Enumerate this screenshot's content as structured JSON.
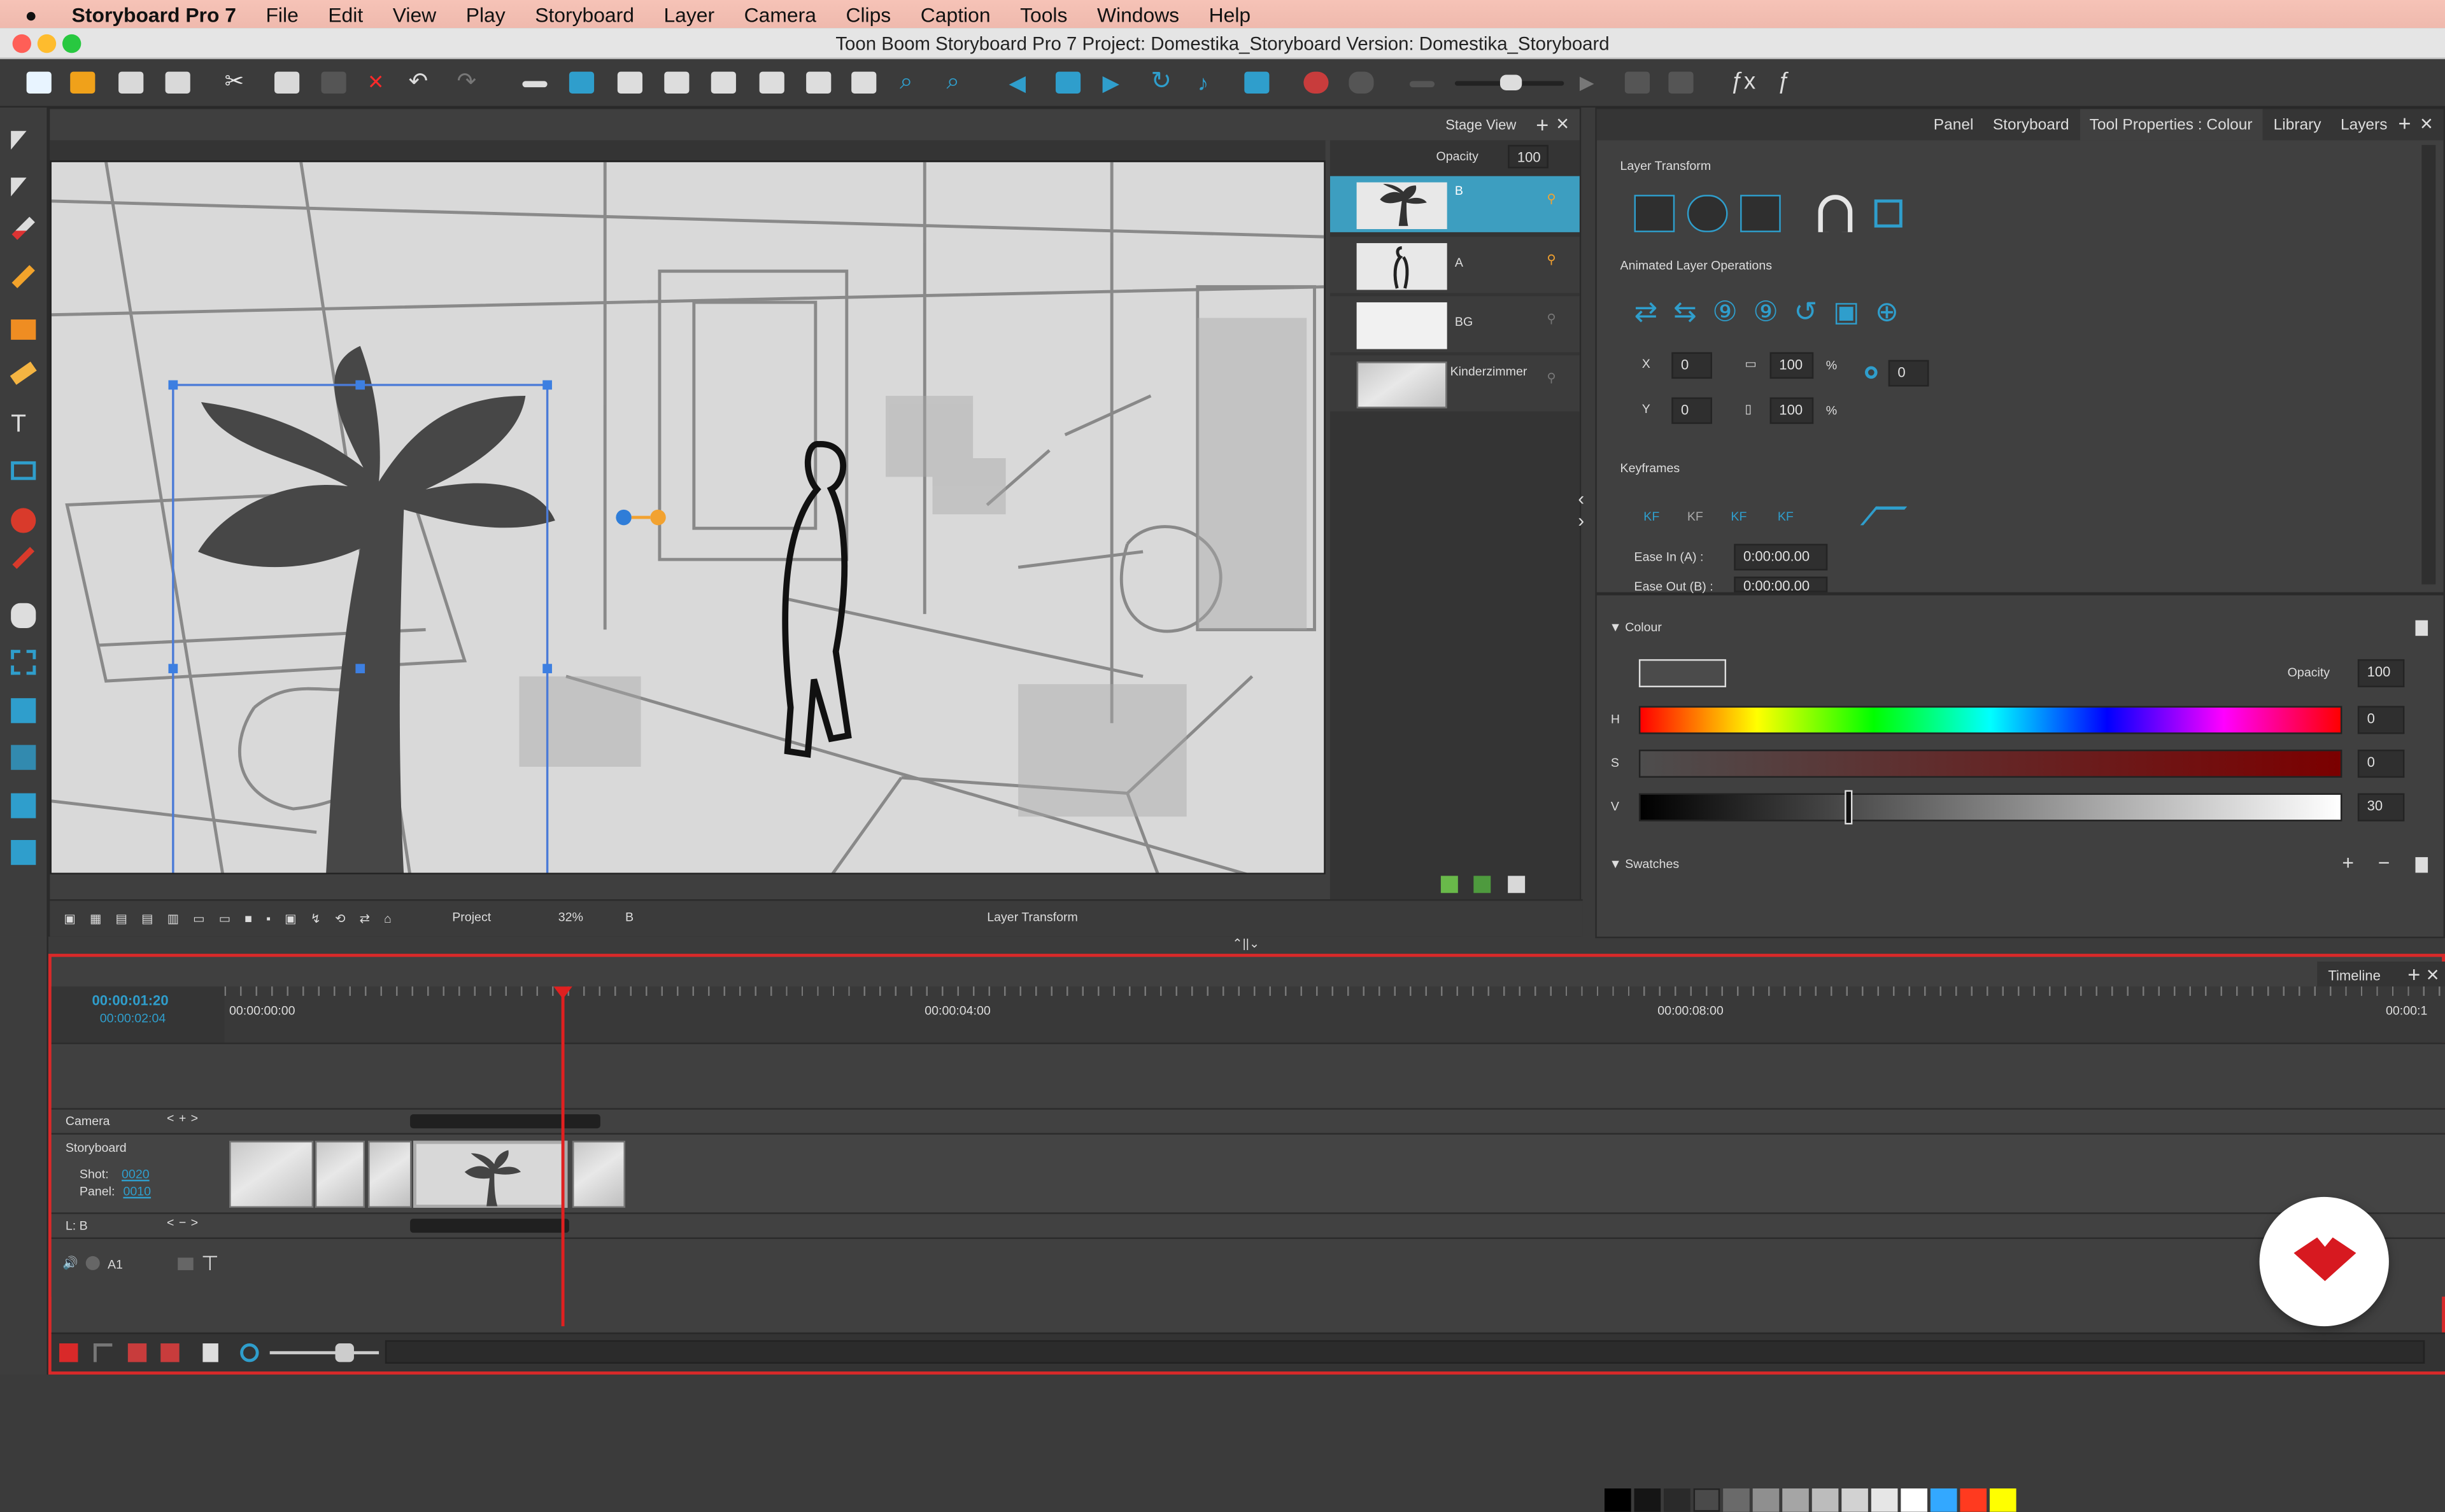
{
  "menubar": {
    "apple": "",
    "app": "Storyboard Pro 7",
    "items": [
      "File",
      "Edit",
      "View",
      "Play",
      "Storyboard",
      "Layer",
      "Camera",
      "Clips",
      "Caption",
      "Tools",
      "Windows",
      "Help"
    ]
  },
  "window": {
    "title": "Toon Boom Storyboard Pro 7 Project: Domestika_Storyboard Version: Domestika_Storyboard"
  },
  "stage": {
    "tab": "Stage View",
    "opacity_label": "Opacity",
    "opacity_value": "100",
    "zoom_mode": "Project",
    "zoom": "32%",
    "layer": "B",
    "transform_label": "Layer Transform"
  },
  "layers": {
    "items": [
      {
        "name": "B",
        "selected": true
      },
      {
        "name": "A",
        "selected": false
      },
      {
        "name": "BG",
        "selected": false
      },
      {
        "name": "Kinderzimmer",
        "selected": false
      }
    ]
  },
  "right_tabs": [
    "Panel",
    "Storyboard",
    "Tool Properties : Colour",
    "Library",
    "Layers"
  ],
  "tool_properties": {
    "layer_transform": "Layer Transform",
    "animated_ops": "Animated Layer Operations",
    "x": "0",
    "y": "0",
    "w": "100",
    "h": "100",
    "angle": "0",
    "percent": "%",
    "keyframes": "Keyframes",
    "ease_in_label": "Ease In (A) :",
    "ease_in": "0:00:00.00",
    "ease_out_label": "Ease Out (B) :",
    "ease_out": "0:00:00.00",
    "kf": [
      "KF",
      "KF",
      "KF",
      "KF"
    ]
  },
  "colour": {
    "header": "Colour",
    "opacity_label": "Opacity",
    "opacity": "100",
    "h_label": "H",
    "h": "0",
    "s_label": "S",
    "s": "0",
    "v_label": "V",
    "v": "30",
    "swatches_header": "Swatches",
    "swatches": [
      "#000000",
      "#151515",
      "#2a2a2a",
      "#4a4a4a",
      "#6a6a6a",
      "#8f8f8f",
      "#a5a5a5",
      "#bcbcbc",
      "#d2d2d2",
      "#e6e6e6",
      "#ffffff",
      "#33a8ff",
      "#ff3a1f",
      "#ffff00"
    ]
  },
  "timeline": {
    "tab": "Timeline",
    "current_time": "00:00:01:20",
    "total_time": "00:00:02:04",
    "t0": "00:00:00:00",
    "t4": "00:00:04:00",
    "t8": "00:00:08:00",
    "tend": "00:00:1",
    "camera_label": "Camera",
    "storyboard_label": "Storyboard",
    "shot_label": "Shot:",
    "shot": "0020",
    "panel_label": "Panel:",
    "panel": "0010",
    "layer_label": "L: B",
    "audio": "A1"
  },
  "colors": {
    "accent": "#2f9ecc",
    "selection": "#3d9ec0",
    "playhead": "#e02020",
    "logo_red": "#d71920"
  },
  "icons": [
    "apple-icon",
    "select-icon",
    "brush-icon",
    "pencil-icon",
    "eraser-icon",
    "text-icon",
    "rectangle-icon",
    "transform-icon",
    "close-icon",
    "plus-icon",
    "minus-icon",
    "speaker-icon",
    "lock-icon",
    "menu-icon"
  ]
}
